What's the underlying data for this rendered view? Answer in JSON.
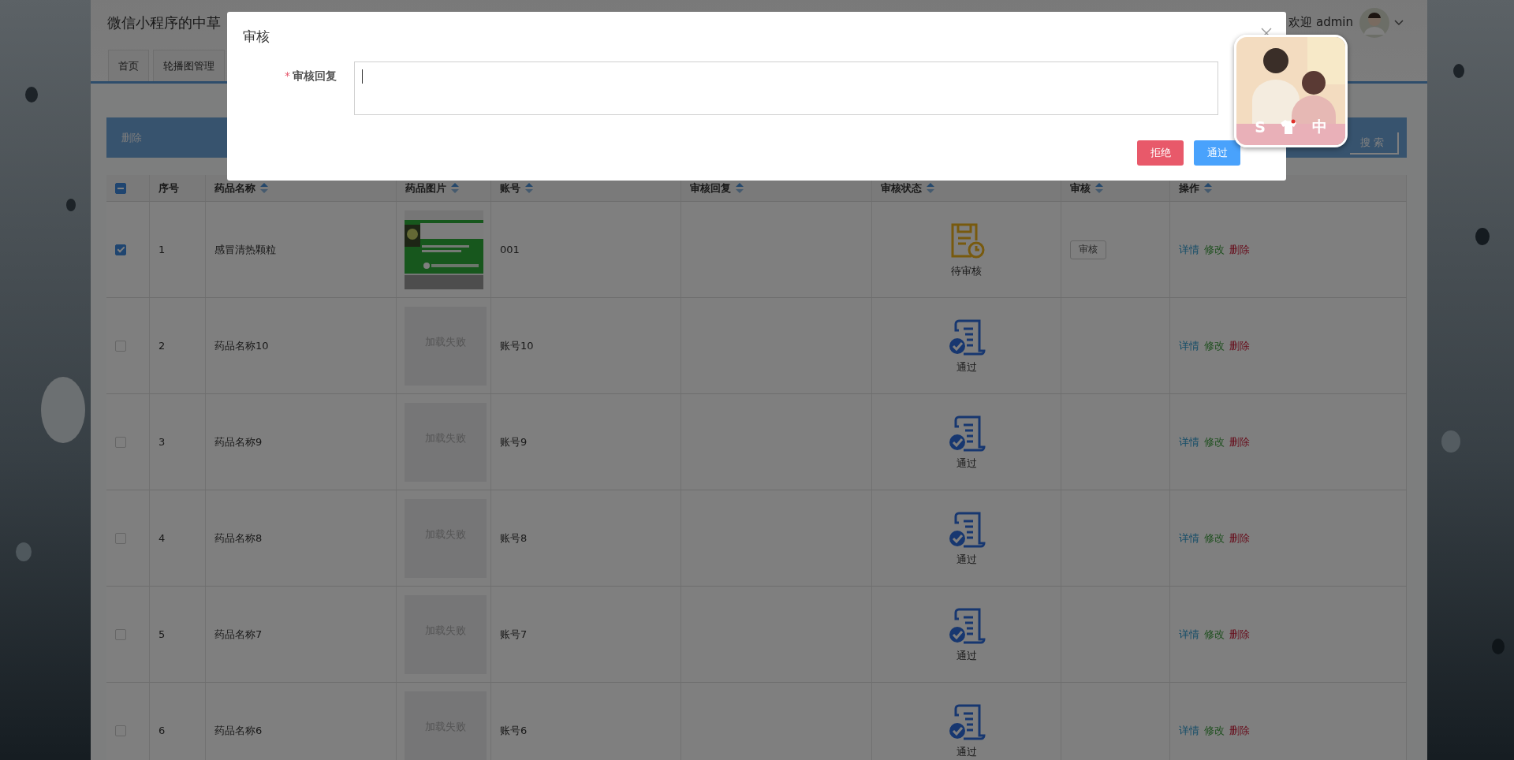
{
  "header": {
    "title": "微信小程序的中草",
    "welcome": "欢迎 admin"
  },
  "tabs": [
    {
      "label": "首页",
      "selected": false
    },
    {
      "label": "轮播图管理",
      "selected": false
    }
  ],
  "toolbar": {
    "delete": "删除",
    "search": "搜索"
  },
  "table": {
    "select_all": {
      "indeterminate": true
    },
    "columns": [
      {
        "label": "序号",
        "sortable": false
      },
      {
        "label": "药品名称",
        "sortable": true
      },
      {
        "label": "药品图片",
        "sortable": true
      },
      {
        "label": "账号",
        "sortable": true
      },
      {
        "label": "审核回复",
        "sortable": true
      },
      {
        "label": "审核状态",
        "sortable": true
      },
      {
        "label": "审核",
        "sortable": true
      },
      {
        "label": "操作",
        "sortable": true
      }
    ],
    "rows": [
      {
        "checked": true,
        "index": "1",
        "name": "感冒清热颗粒",
        "account": "001",
        "status": {
          "kind": "pending",
          "label": "待审核"
        },
        "review": "审核",
        "actions": [
          "详情",
          "修改",
          "删除"
        ]
      },
      {
        "checked": false,
        "index": "2",
        "name": "药品名称10",
        "image": {
          "kind": "error",
          "text": "加载失败"
        },
        "account": "账号10",
        "status": {
          "kind": "approved",
          "label": "通过"
        },
        "actions": [
          "详情",
          "修改",
          "删除"
        ]
      },
      {
        "checked": false,
        "index": "3",
        "name": "药品名称9",
        "image": {
          "kind": "error",
          "text": "加载失败"
        },
        "account": "账号9",
        "status": {
          "kind": "approved",
          "label": "通过"
        },
        "actions": [
          "详情",
          "修改",
          "删除"
        ]
      },
      {
        "checked": false,
        "index": "4",
        "name": "药品名称8",
        "image": {
          "kind": "error",
          "text": "加载失败"
        },
        "account": "账号8",
        "status": {
          "kind": "approved",
          "label": "通过"
        },
        "actions": [
          "详情",
          "修改",
          "删除"
        ]
      },
      {
        "checked": false,
        "index": "5",
        "name": "药品名称7",
        "image": {
          "kind": "error",
          "text": "加载失败"
        },
        "account": "账号7",
        "status": {
          "kind": "approved",
          "label": "通过"
        },
        "actions": [
          "详情",
          "修改",
          "删除"
        ]
      },
      {
        "checked": false,
        "index": "6",
        "name": "药品名称6",
        "image": {
          "kind": "error",
          "text": "加载失败"
        },
        "account": "账号6",
        "status": {
          "kind": "approved",
          "label": "通过"
        },
        "actions": [
          "详情",
          "修改",
          "删除"
        ]
      }
    ]
  },
  "modal": {
    "title": "审核",
    "field": {
      "label": "审核回复",
      "required_mark": "*",
      "focused": true
    },
    "buttons": [
      {
        "label": "拒绝",
        "kind": "danger"
      },
      {
        "label": "通过",
        "kind": "primary"
      }
    ]
  },
  "ime": {
    "logo": "S",
    "mode": "中"
  }
}
